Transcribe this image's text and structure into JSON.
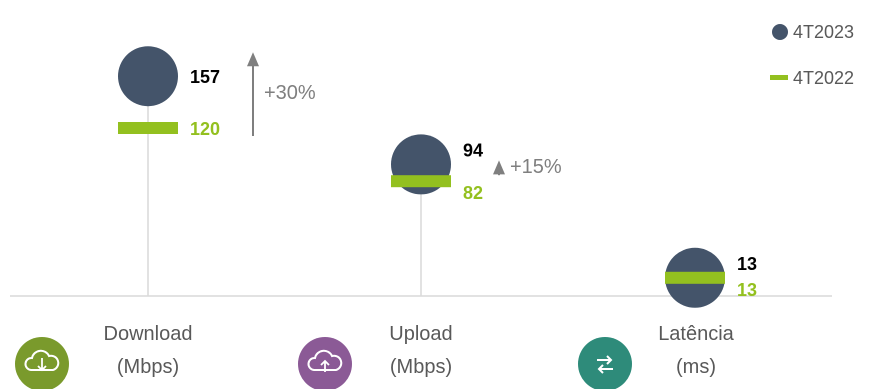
{
  "chart_data": {
    "type": "dot-comparison",
    "categories": [
      {
        "label_line1": "Download",
        "label_line2": "(Mbps)",
        "icon": "cloud-download-icon"
      },
      {
        "label_line1": "Upload",
        "label_line2": "(Mbps)",
        "icon": "cloud-upload-icon"
      },
      {
        "label_line1": "Latência",
        "label_line2": "(ms)",
        "icon": "swap-arrows-icon"
      }
    ],
    "series": [
      {
        "name": "4T2023",
        "marker": "circle",
        "values": [
          157,
          94,
          13
        ]
      },
      {
        "name": "4T2022",
        "marker": "bar",
        "values": [
          120,
          82,
          13
        ]
      }
    ],
    "changes": [
      "+30%",
      "+15%",
      ""
    ],
    "ylim": [
      0,
      180
    ],
    "legend_position": "top-right",
    "grid": false
  },
  "colors": {
    "series_2023": "#44546A",
    "series_2022": "#93C01F",
    "text": "#595959",
    "change_arrow": "#7F7F7F",
    "axis": "#D9D9D9",
    "icon_download": "#7A9A2C",
    "icon_upload": "#8B5A96",
    "icon_latency": "#2E8B7A"
  }
}
